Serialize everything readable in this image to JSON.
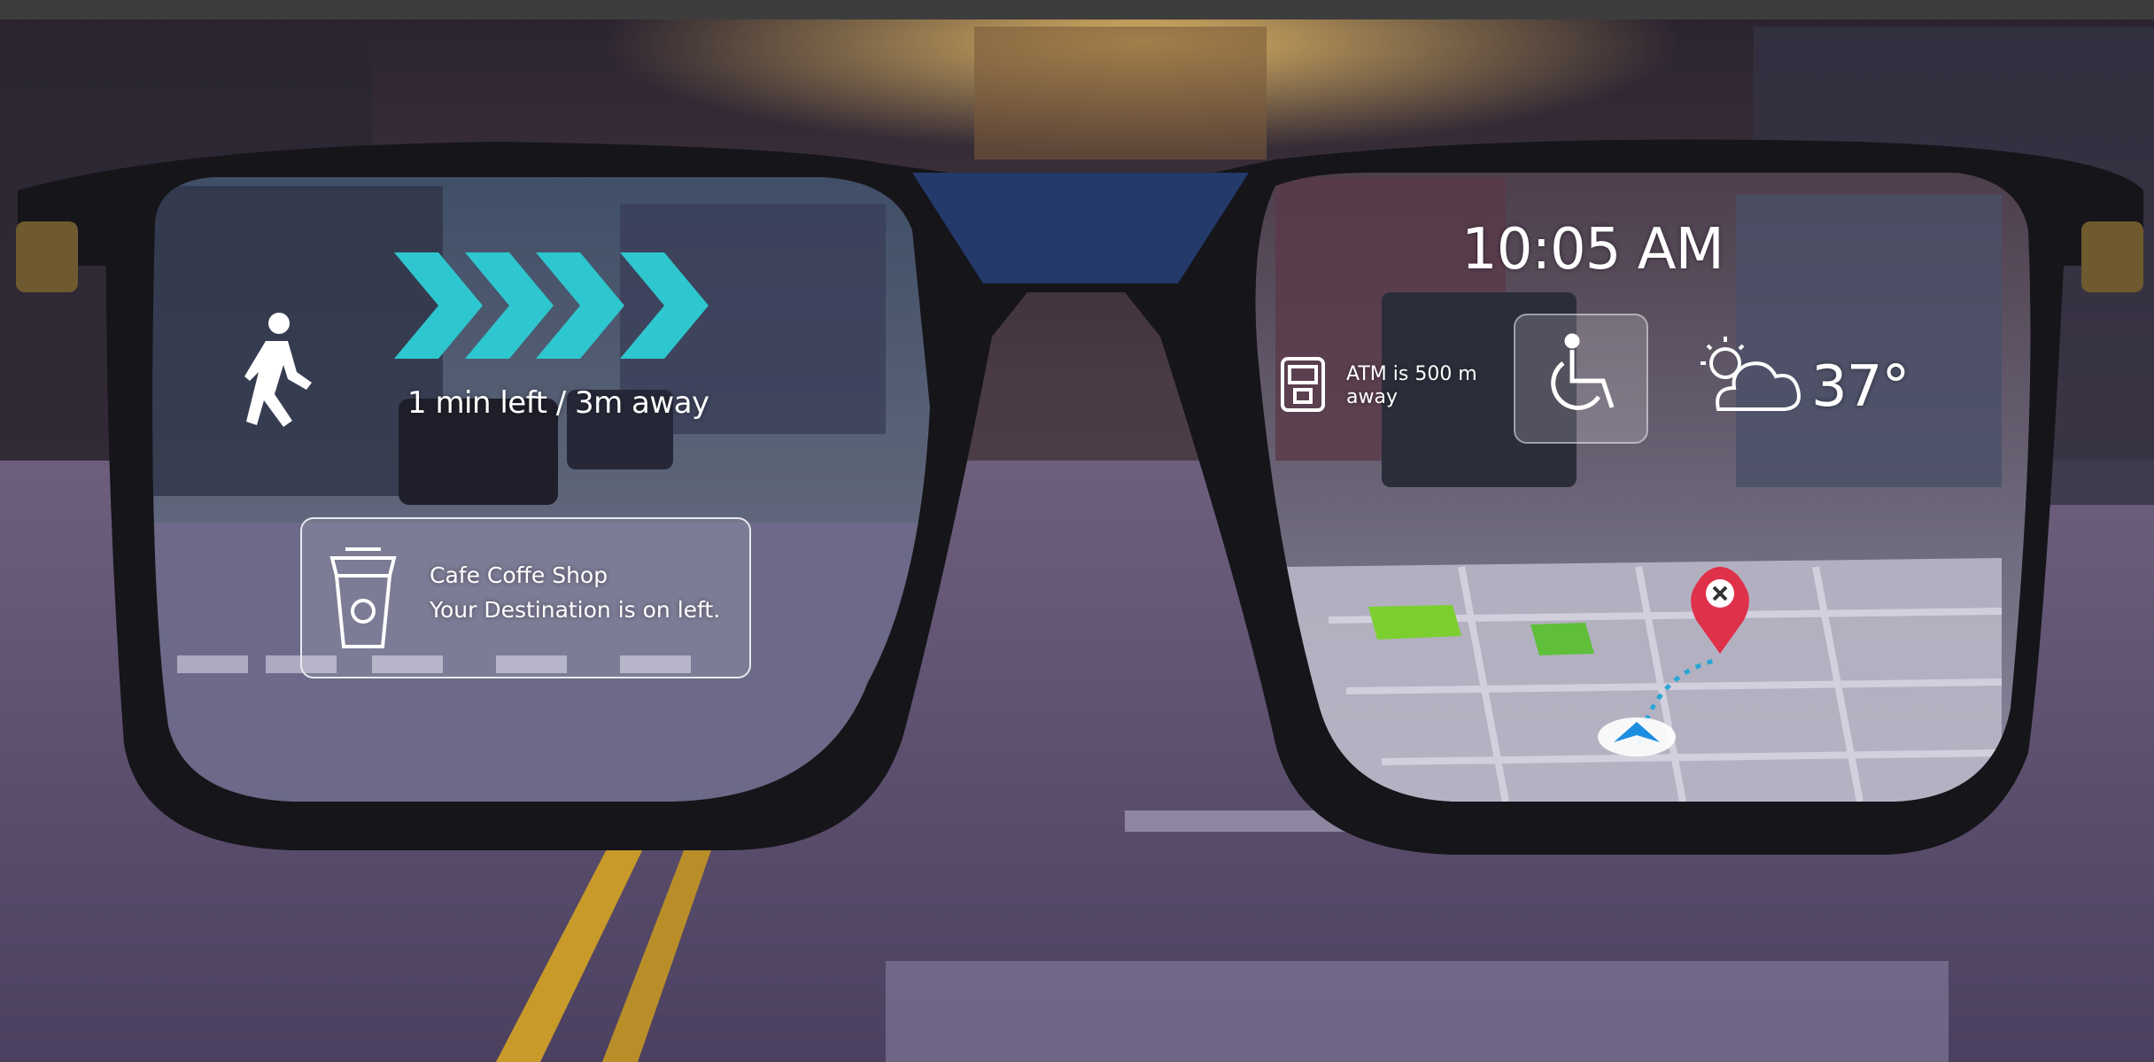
{
  "left_lens": {
    "walk_status": "1 min left / 3m away",
    "destination_card": {
      "title": "Cafe Coffe Shop",
      "subtitle": "Your Destination is on left."
    }
  },
  "right_lens": {
    "time": "10:05 AM",
    "atm_notice": "ATM is 500 m away",
    "temperature": "37°"
  },
  "icons": {
    "walk": "pedestrian-icon",
    "direction": "chevron-arrows-icon",
    "cup": "coffee-cup-icon",
    "atm": "atm-icon",
    "accessibility": "wheelchair-icon",
    "weather": "partly-cloudy-icon",
    "destination": "map-pin-icon",
    "position": "navigation-arrow-icon"
  },
  "colors": {
    "accent_teal": "#2ec6cf",
    "pin_red": "#e0314a",
    "map_green": "#7ccf2f",
    "frame": "#15151a",
    "bridge": "#233a6a"
  }
}
